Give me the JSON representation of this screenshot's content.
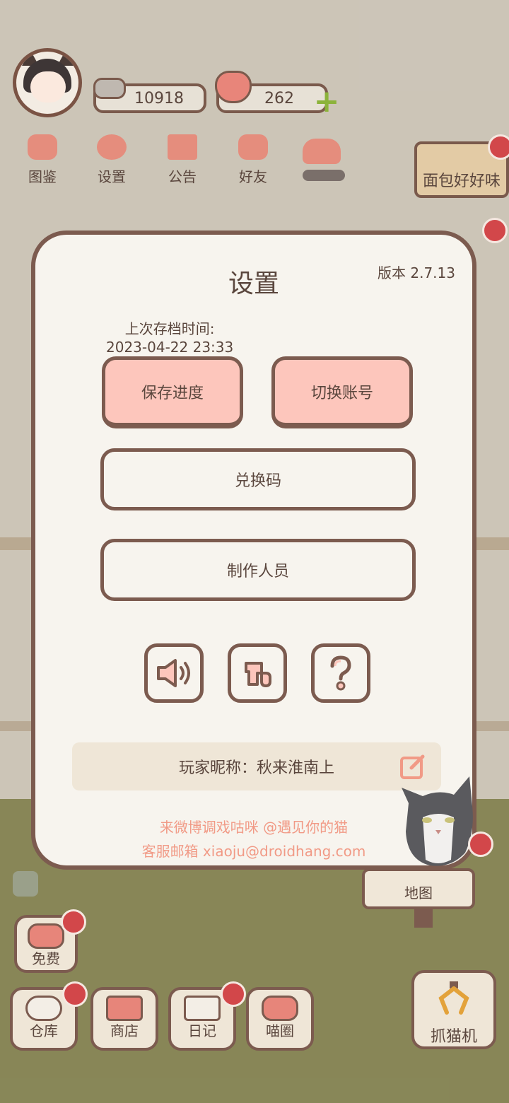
{
  "hud": {
    "fish_count": "10918",
    "heart_count": "262",
    "menu": [
      "图鉴",
      "设置",
      "公告",
      "好友"
    ],
    "bread_sign": "面包好好味"
  },
  "settings": {
    "title": "设置",
    "version": "版本 2.7.13",
    "last_save_label": "上次存档时间:",
    "last_save_time": "2023-04-22 23:33",
    "save_button": "保存进度",
    "switch_account_button": "切换账号",
    "redeem_button": "兑换码",
    "credits_button": "制作人员",
    "nickname": "玩家昵称：秋来淮南上",
    "footer_weibo": "来微博调戏咕咪 @遇见你的猫",
    "footer_email": "客服邮箱 xiaoju@droidhang.com"
  },
  "bottom_nav": {
    "free": "免费",
    "storage": "仓库",
    "shop": "商店",
    "diary": "日记",
    "meow_circle": "喵圈",
    "claw_machine": "抓猫机",
    "map": "地图"
  },
  "colors": {
    "accent_pink": "#fdc6bc",
    "border_brown": "#7c5b4f",
    "footer_text": "#f19a86",
    "modal_bg": "#f7f4ee"
  },
  "icons": [
    "sound-icon",
    "music-icon",
    "help-icon",
    "edit-icon",
    "plus-icon"
  ]
}
